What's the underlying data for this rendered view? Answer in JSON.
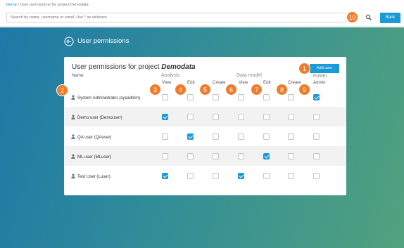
{
  "breadcrumb": {
    "home": "Home",
    "separator": "/",
    "current": "User permissions for project Demodata"
  },
  "search": {
    "placeholder": "Search by name, username or email. Use * as wildcard"
  },
  "top": {
    "back_label": "Back"
  },
  "header": {
    "title": "User permissions"
  },
  "card": {
    "title_prefix": "User permissions for  project",
    "project": "Demodata",
    "add_user_label": "Add user",
    "name_header": "Name",
    "analysis_label": "Analysis",
    "data_model_label": "Data model",
    "folder_label": "Folder",
    "columns": [
      "View",
      "Edit",
      "Create",
      "View",
      "Edit",
      "Create",
      "Admin"
    ]
  },
  "users": [
    {
      "name": "System Administrator (sysadmin)",
      "perms": [
        false,
        false,
        false,
        false,
        false,
        false,
        true
      ]
    },
    {
      "name": "Demo user (Demouser)",
      "perms": [
        true,
        false,
        false,
        false,
        false,
        false,
        false
      ]
    },
    {
      "name": "QA user (QAuser)",
      "perms": [
        false,
        true,
        false,
        false,
        false,
        false,
        false
      ]
    },
    {
      "name": "ML user (MLuser)",
      "perms": [
        false,
        false,
        false,
        false,
        true,
        false,
        false
      ]
    },
    {
      "name": "Test User (Luser)",
      "perms": [
        true,
        false,
        false,
        true,
        false,
        false,
        false
      ]
    }
  ],
  "badges": [
    "1",
    "2",
    "3",
    "4",
    "5",
    "6",
    "7",
    "8",
    "9",
    "10"
  ],
  "colors": {
    "accent": "#1a9ad6",
    "badge": "#f07b2b",
    "gradient_start": "#1f78a6",
    "gradient_end": "#52a27d"
  }
}
